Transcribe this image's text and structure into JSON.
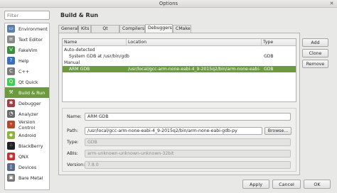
{
  "window": {
    "title": "Options"
  },
  "filter": {
    "placeholder": "Filter",
    "value": ""
  },
  "sidebar": {
    "items": [
      {
        "label": "Environment",
        "icon": "monitor-icon",
        "color": "#5a7fa8"
      },
      {
        "label": "Text Editor",
        "icon": "document-icon",
        "color": "#8a8a8a"
      },
      {
        "label": "FakeVim",
        "icon": "vim-icon",
        "color": "#3b8e3b"
      },
      {
        "label": "Help",
        "icon": "help-icon",
        "color": "#3b6fb6"
      },
      {
        "label": "C++",
        "icon": "cpp-icon",
        "color": "#7a7a7a"
      },
      {
        "label": "Qt Quick",
        "icon": "qt-quick-icon",
        "color": "#41cd52"
      },
      {
        "label": "Build & Run",
        "icon": "build-run-icon",
        "color": "#6c9a3d"
      },
      {
        "label": "Debugger",
        "icon": "debugger-icon",
        "color": "#a04040"
      },
      {
        "label": "Analyzer",
        "icon": "analyzer-icon",
        "color": "#6a6a6a"
      },
      {
        "label": "Version Control",
        "icon": "version-control-icon",
        "color": "#b04a2a"
      },
      {
        "label": "Android",
        "icon": "android-icon",
        "color": "#8fb33a"
      },
      {
        "label": "BlackBerry",
        "icon": "blackberry-icon",
        "color": "#222222"
      },
      {
        "label": "QNX",
        "icon": "qnx-icon",
        "color": "#c03030"
      },
      {
        "label": "Devices",
        "icon": "devices-icon",
        "color": "#5a6a8a"
      },
      {
        "label": "Bare Metal",
        "icon": "bare-metal-icon",
        "color": "#777777"
      }
    ],
    "selected_index": 6
  },
  "page": {
    "heading": "Build & Run"
  },
  "tabs": [
    {
      "label": "General"
    },
    {
      "label": "Kits"
    },
    {
      "label": "Qt Versions"
    },
    {
      "label": "Compilers"
    },
    {
      "label": "Debuggers"
    },
    {
      "label": "CMake"
    }
  ],
  "active_tab": "Debuggers",
  "table": {
    "headers": [
      "Name",
      "Location",
      "Type"
    ],
    "groups": [
      {
        "label": "Auto-detected",
        "rows": [
          {
            "name": "System GDB at /usr/bin/gdb",
            "location": "/usr/bin/gdb",
            "type": "GDB"
          }
        ]
      },
      {
        "label": "Manual",
        "rows": [
          {
            "name": "ARM GDB",
            "location": "/usr/local/gcc-arm-none-eabi-4_9-2015q2/bin/arm-none-eabi-gdb-py",
            "type": "GDB",
            "selected": true
          }
        ]
      }
    ]
  },
  "buttons": {
    "add": "Add",
    "clone": "Clone",
    "remove": "Remove"
  },
  "details": {
    "name_label": "Name:",
    "name_value": "ARM GDB",
    "path_label": "Path:",
    "path_value": "/usr/local/gcc-arm-none-eabi-4_9-2015q2/bin/arm-none-eabi-gdb-py",
    "browse_label": "Browse...",
    "type_label": "Type:",
    "type_value": "GDB",
    "abis_label": "ABIs:",
    "abis_value": "arm-unknown-unknown-unknown-32bit",
    "version_label": "Version:",
    "version_value": "7.8.0"
  },
  "footer": {
    "apply": "Apply",
    "cancel": "Cancel",
    "ok": "OK"
  },
  "colors": {
    "accent": "#6c9a3d"
  }
}
